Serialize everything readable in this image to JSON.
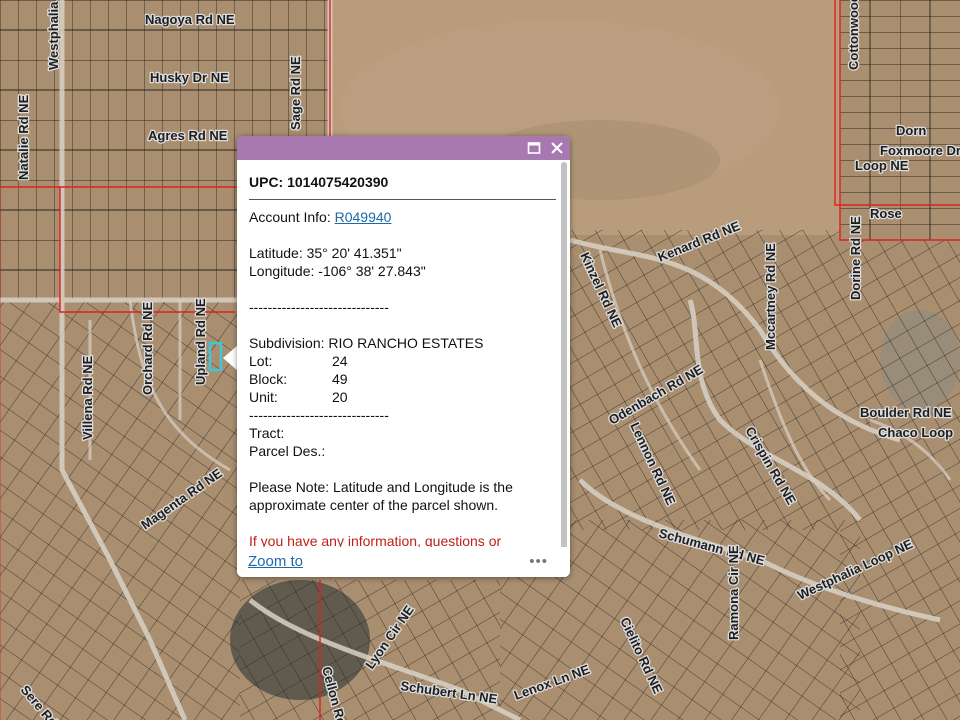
{
  "map": {
    "roads": [
      "Nagoya Rd NE",
      "Husky Dr NE",
      "Agres Rd NE",
      "Westphalia Blvd NE",
      "Natalie Rd NE",
      "Sage Rd NE",
      "Orchard Rd NE",
      "Upland Rd NE",
      "Villena Rd NE",
      "Magenta Rd NE",
      "Kinzel Rd NE",
      "Kenard Rd NE",
      "Mccartney Rd NE",
      "Odenbach Rd NE",
      "Schumann Rd NE",
      "Lennon Rd NE",
      "Crispin Rd NE",
      "Boulder Rd NE",
      "Chaco Loop",
      "Dorn",
      "Foxmoore Dr",
      "Loop NE",
      "Dorine Rd NE",
      "Rose",
      "Cottonwood",
      "Westphalia Loop NE",
      "Ramona Cir NE",
      "Schubert Ln NE",
      "Lenox Ln NE",
      "Cielito Rd NE",
      "Lyon Cir NE",
      "Cellon Rd",
      "Sere Rd NE"
    ],
    "colors": {
      "terrain": "#a98e70",
      "parcel_line": "#2a2620",
      "boundary": "#e02020",
      "selected": "#3ec8d8"
    }
  },
  "popup": {
    "title": "UPC: 1014075420390",
    "account_label": "Account Info: ",
    "account_link": "R049940",
    "latitude": "Latitude: 35° 20' 41.351\"",
    "longitude": "Longitude: -106° 38' 27.843\"",
    "separator": "------------------------------",
    "subdivision": "Subdivision: RIO RANCHO ESTATES",
    "lot_label": "Lot:",
    "lot_value": "24",
    "block_label": "Block:",
    "block_value": "49",
    "unit_label": "Unit:",
    "unit_value": "20",
    "tract": "Tract:",
    "parcel_des": "Parcel Des.:",
    "note": "Please Note: Latitude and Longitude is the approximate center of the parcel shown.",
    "info_request": "If you have any information, questions or",
    "zoom_to": "Zoom to",
    "more": "•••",
    "header_color": "#a878b0",
    "maximize_icon": "maximize-icon",
    "close_icon": "close-icon"
  }
}
